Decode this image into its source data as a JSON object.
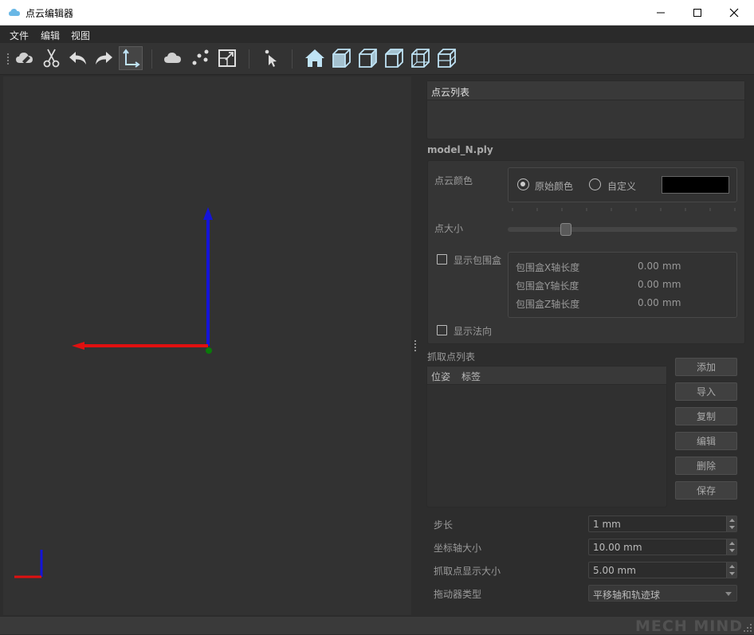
{
  "window": {
    "title": "点云编辑器",
    "controls": {
      "minimize": "minimize-icon",
      "maximize": "maximize-icon",
      "close": "close-icon"
    }
  },
  "menu": [
    "文件",
    "编辑",
    "视图"
  ],
  "toolbar": {
    "icons": [
      "erase-cloud-icon",
      "scissors-icon",
      "undo-icon",
      "redo-icon",
      "axes-icon",
      "cloud-icon",
      "points-icon",
      "bounding-box-icon",
      "pointer-icon",
      "home-icon",
      "view-front-icon",
      "view-back-icon",
      "view-left-icon",
      "view-right-icon",
      "view-top-icon"
    ]
  },
  "point_cloud_list": {
    "header": "点云列表"
  },
  "model": {
    "filename": "model_N.ply",
    "color_label": "点云颜色",
    "color_original": "原始颜色",
    "color_custom": "自定义",
    "custom_color": "#000000",
    "selected": "原始颜色",
    "point_size_label": "点大小",
    "point_size_fraction": 0.24,
    "show_bbox_label": "显示包围盒",
    "show_bbox": false,
    "bbox": [
      {
        "label": "包围盒X轴长度",
        "value": "0.00",
        "unit": "mm"
      },
      {
        "label": "包围盒Y轴长度",
        "value": "0.00",
        "unit": "mm"
      },
      {
        "label": "包围盒Z轴长度",
        "value": "0.00",
        "unit": "mm"
      }
    ],
    "show_normal_label": "显示法向",
    "show_normal": false
  },
  "pick_list": {
    "header": "抓取点列表",
    "columns": [
      "位姿",
      "标签"
    ],
    "buttons": [
      "添加",
      "导入",
      "复制",
      "编辑",
      "删除",
      "保存"
    ]
  },
  "settings": [
    {
      "label": "步长",
      "value": "1 mm"
    },
    {
      "label": "坐标轴大小",
      "value": "10.00 mm"
    },
    {
      "label": "抓取点显示大小",
      "value": "5.00 mm"
    },
    {
      "label": "拖动器类型",
      "value": "平移轴和轨迹球"
    }
  ],
  "watermark": "MECH MIND",
  "colors": {
    "axis_x": "#e01010",
    "axis_z": "#1010d0",
    "origin": "#0a7a0a",
    "icon_blue": "#bfe3f5"
  }
}
